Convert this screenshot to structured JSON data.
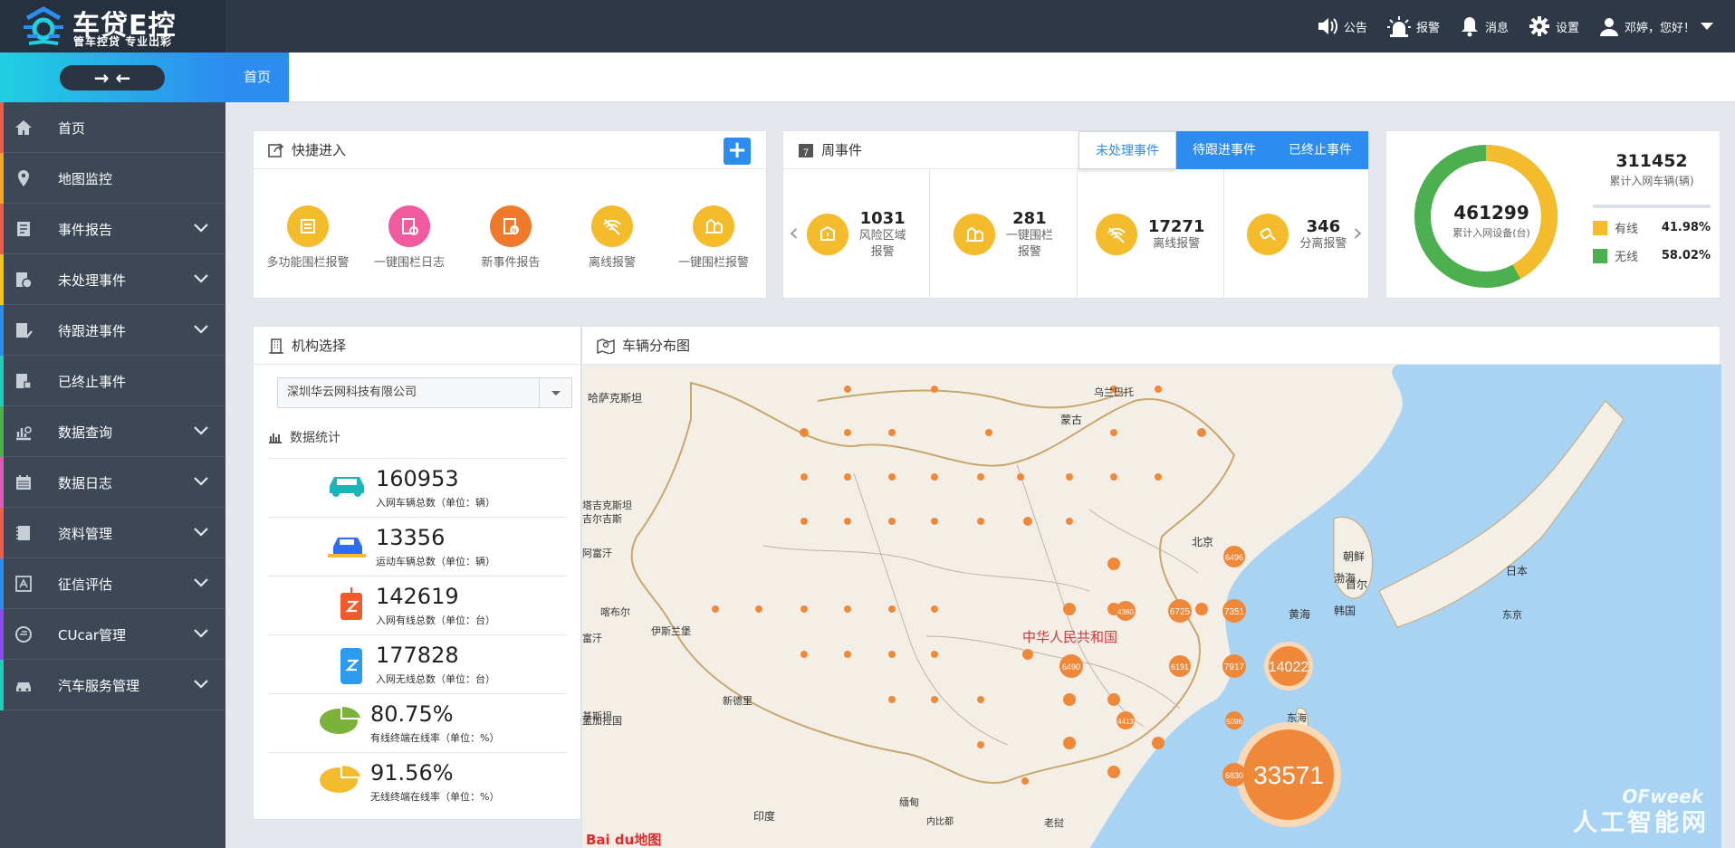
{
  "app": {
    "title": "车贷E控",
    "subtitle": "管车控贷 专业出彩"
  },
  "topnav": [
    {
      "label": "公告",
      "icon": "speaker-icon"
    },
    {
      "label": "报警",
      "icon": "alarm-icon"
    },
    {
      "label": "消息",
      "icon": "bell-icon"
    },
    {
      "label": "设置",
      "icon": "gear-icon"
    },
    {
      "label": "邓婷，您好！",
      "icon": "user-icon"
    }
  ],
  "sidebar": {
    "toggle": "→ ←",
    "items": [
      {
        "label": "首页",
        "icon": "home-icon",
        "color": "#f05a4a",
        "expandable": false
      },
      {
        "label": "地图监控",
        "icon": "map-pin-icon",
        "color": "#f5a623",
        "expandable": false
      },
      {
        "label": "事件报告",
        "icon": "report-icon",
        "color": "#f05a4a",
        "expandable": true
      },
      {
        "label": "未处理事件",
        "icon": "pending-event-icon",
        "color": "#f5c518",
        "expandable": true
      },
      {
        "label": "待跟进事件",
        "icon": "follow-event-icon",
        "color": "#2d8cf0",
        "expandable": true
      },
      {
        "label": "已终止事件",
        "icon": "terminated-event-icon",
        "color": "#1fd0b8",
        "expandable": false
      },
      {
        "label": "数据查询",
        "icon": "data-query-icon",
        "color": "#4caf50",
        "expandable": true
      },
      {
        "label": "数据日志",
        "icon": "calendar-icon",
        "color": "#e05bb8",
        "expandable": true
      },
      {
        "label": "资料管理",
        "icon": "book-icon",
        "color": "#f05a4a",
        "expandable": true
      },
      {
        "label": "征信评估",
        "icon": "credit-icon",
        "color": "#2d8cf0",
        "expandable": true
      },
      {
        "label": "CUcar管理",
        "icon": "cucar-icon",
        "color": "#8a4cf0",
        "expandable": true
      },
      {
        "label": "汽车服务管理",
        "icon": "car-service-icon",
        "color": "#1fd0b8",
        "expandable": true
      }
    ]
  },
  "tabs": [
    {
      "label": "首页",
      "active": true
    }
  ],
  "quick": {
    "title": "快捷进入",
    "items": [
      {
        "label": "多功能围栏报警",
        "color": "#f4bc2c",
        "icon": "multi-fence-icon"
      },
      {
        "label": "一键围栏日志",
        "color": "#f25aa0",
        "icon": "fence-log-icon"
      },
      {
        "label": "新事件报告",
        "color": "#f0792c",
        "icon": "new-event-icon"
      },
      {
        "label": "离线报警",
        "color": "#f4bc2c",
        "icon": "offline-icon"
      },
      {
        "label": "一键围栏报警",
        "color": "#f4bc2c",
        "icon": "fence-alarm-icon"
      }
    ]
  },
  "week": {
    "badge": "7",
    "title": "周事件",
    "tabs": [
      {
        "label": "未处理事件",
        "active": true
      },
      {
        "label": "待跟进事件",
        "active": false
      },
      {
        "label": "已终止事件",
        "active": false
      }
    ],
    "items": [
      {
        "num": "1031",
        "label1": "风险区域",
        "label2": "报警",
        "icon": "risk-area-icon"
      },
      {
        "num": "281",
        "label1": "一键围栏",
        "label2": "报警",
        "icon": "fence-alarm-icon"
      },
      {
        "num": "17271",
        "label1": "离线报警",
        "label2": "",
        "icon": "offline-icon"
      },
      {
        "num": "346",
        "label1": "分离报警",
        "label2": "",
        "icon": "detach-icon"
      }
    ]
  },
  "devices": {
    "total": "461299",
    "total_label": "累计入网设备(台)",
    "vehicles": "311452",
    "vehicles_label": "累计入网车辆(辆)",
    "legend": [
      {
        "label": "有线",
        "value": "41.98%",
        "fraction": 0.4198,
        "color": "#f4bc2c"
      },
      {
        "label": "无线",
        "value": "58.02%",
        "fraction": 0.5802,
        "color": "#4caf50"
      }
    ]
  },
  "org": {
    "title": "机构选择",
    "selected": "深圳华云网科技有限公司",
    "stats_title": "数据统计",
    "stats": [
      {
        "num": "160953",
        "label": "入网车辆总数（单位：辆）",
        "icon": "car-icon"
      },
      {
        "num": "13356",
        "label": "运动车辆总数（单位：辆）",
        "icon": "moving-car-icon"
      },
      {
        "num": "142619",
        "label": "入网有线总数（单位：台）",
        "icon": "wired-device-icon"
      },
      {
        "num": "177828",
        "label": "入网无线总数（单位：台）",
        "icon": "wireless-device-icon"
      },
      {
        "num": "80.75%",
        "label": "有线终端在线率（单位：%）",
        "icon": "pie-green-icon"
      },
      {
        "num": "91.56%",
        "label": "无线终端在线率（单位：%）",
        "icon": "pie-yellow-icon"
      }
    ]
  },
  "map": {
    "title": "车辆分布图",
    "places": [
      "哈萨克斯坦",
      "蒙古",
      "乌兰巴托",
      "北京",
      "朝鲜",
      "渤海",
      "首尔",
      "韩国",
      "黄海",
      "日本",
      "东京",
      "中华人民共和国",
      "喀布尔",
      "伊斯兰堡",
      "塔吉克斯坦",
      "吉尔吉斯",
      "阿富汗",
      "新德里",
      "孟加拉国",
      "缅甸",
      "印度",
      "老挝",
      "内比都",
      "东海",
      "富汗",
      "基斯坦"
    ],
    "clusters": [
      "33571",
      "14022",
      "7917",
      "7351",
      "6725",
      "6496",
      "6191",
      "6490",
      "6830",
      "5096",
      "4413",
      "4360"
    ],
    "baidu": "Bai du地图",
    "watermark1": "OFweek",
    "watermark2": "人工智能网"
  }
}
